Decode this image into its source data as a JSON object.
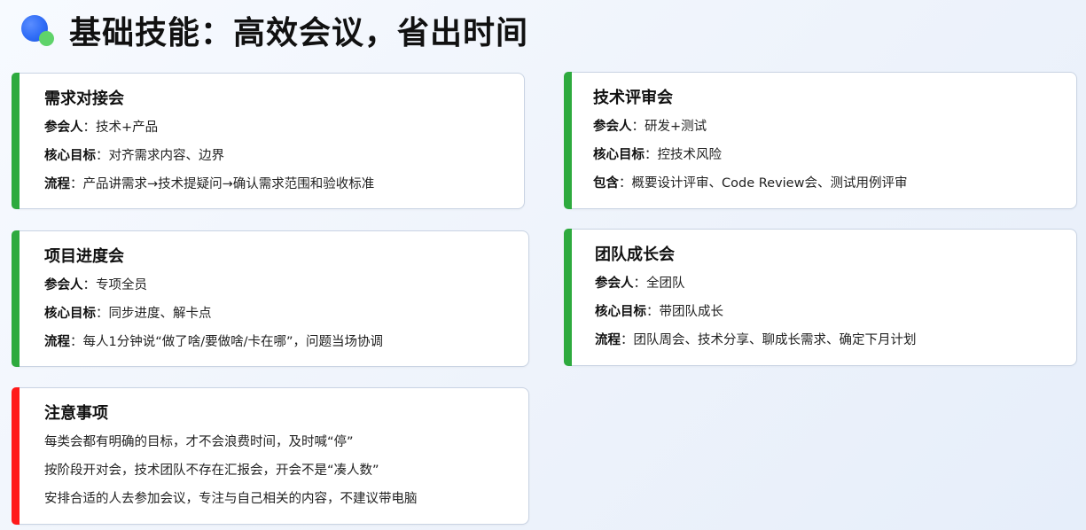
{
  "page": {
    "title": "基础技能：高效会议，省出时间"
  },
  "colors": {
    "accent_green": "#2eaa3e",
    "accent_red": "#ff1a1a",
    "logo_blue": "#2f6cf6",
    "logo_green": "#5fd36a"
  },
  "cards": {
    "demand": {
      "title": "需求对接会",
      "participants_label": "参会人",
      "participants_value": "：技术+产品",
      "goal_label": "核心目标",
      "goal_value": "：对齐需求内容、边界",
      "flow_label": "流程",
      "flow_value": "：产品讲需求→技术提疑问→确认需求范围和验收标准"
    },
    "tech_review": {
      "title": "技术评审会",
      "participants_label": "参会人",
      "participants_value": "：研发+测试",
      "goal_label": "核心目标",
      "goal_value": "：控技术风险",
      "include_label": "包含",
      "include_value": "：概要设计评审、Code Review会、测试用例评审"
    },
    "progress": {
      "title": "项目进度会",
      "participants_label": "参会人",
      "participants_value": "：专项全员",
      "goal_label": "核心目标",
      "goal_value": "：同步进度、解卡点",
      "flow_label": "流程",
      "flow_value": "：每人1分钟说“做了啥/要做啥/卡在哪”，问题当场协调"
    },
    "team_growth": {
      "title": "团队成长会",
      "participants_label": "参会人",
      "participants_value": "：全团队",
      "goal_label": "核心目标",
      "goal_value": "：带团队成长",
      "flow_label": "流程",
      "flow_value": "：团队周会、技术分享、聊成长需求、确定下月计划"
    },
    "notes": {
      "title": "注意事项",
      "items": [
        "每类会都有明确的目标，才不会浪费时间，及时喊“停”",
        "按阶段开对会，技术团队不存在汇报会，开会不是“凑人数”",
        "安排合适的人去参加会议，专注与自己相关的内容，不建议带电脑"
      ]
    }
  }
}
